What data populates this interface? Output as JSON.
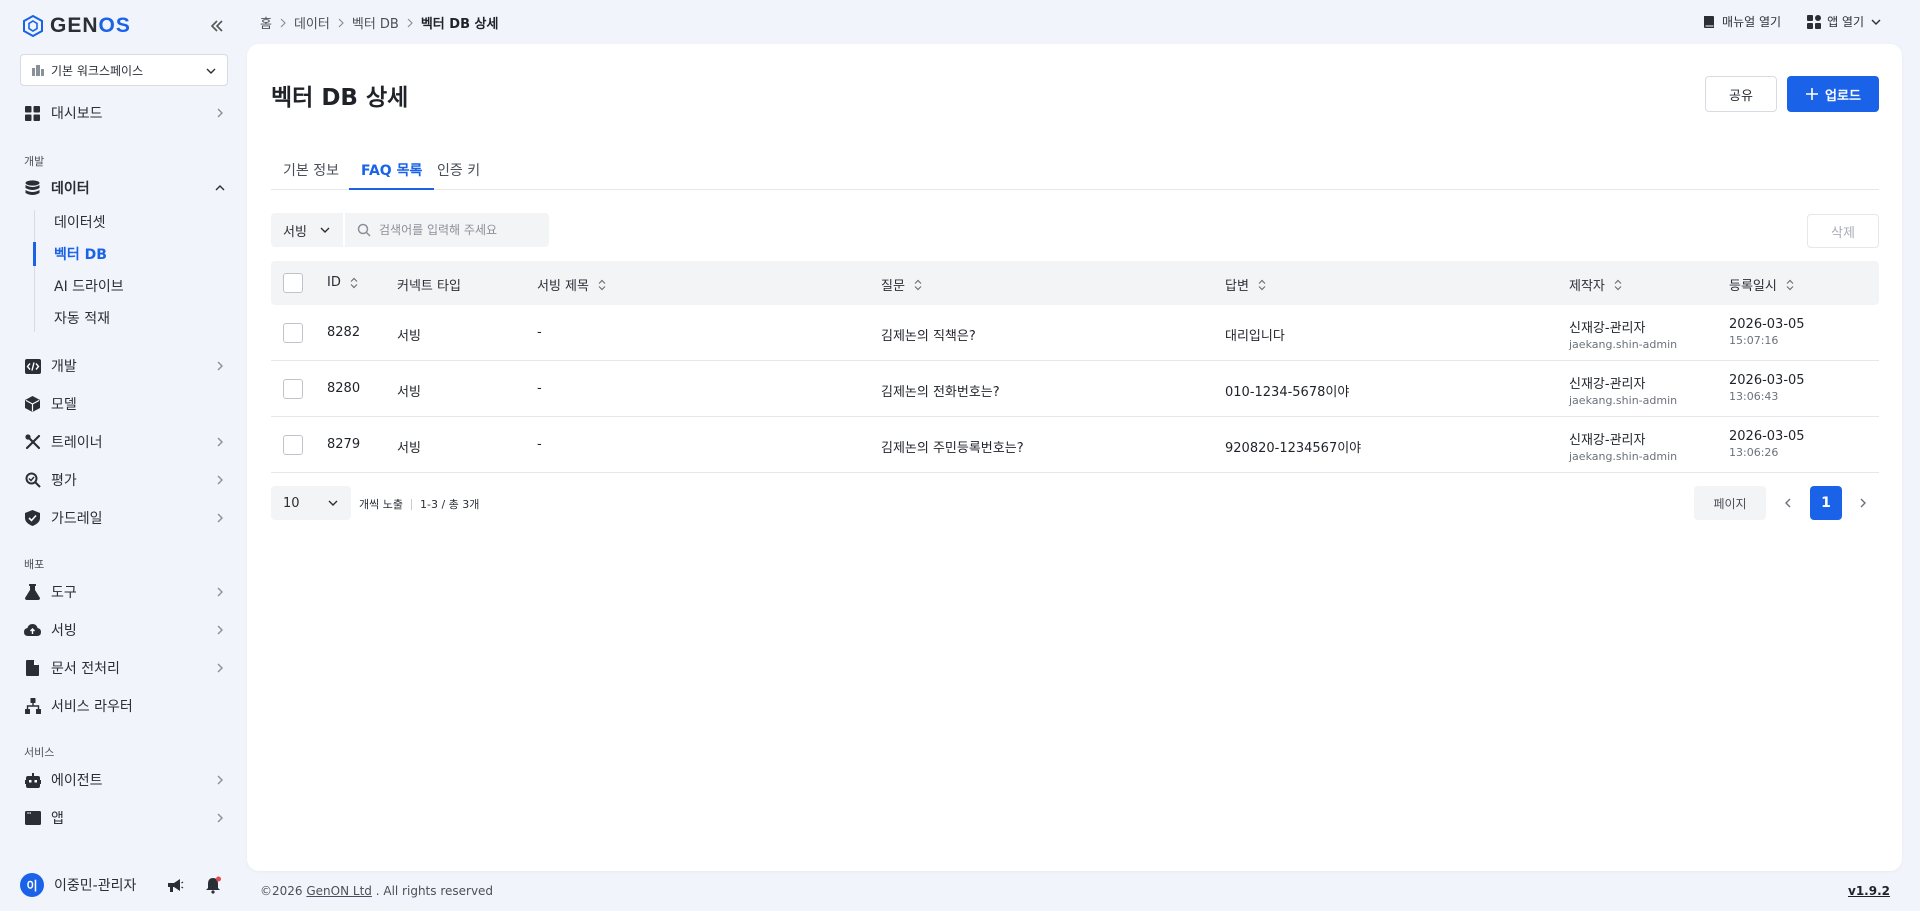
{
  "app": {
    "logo_prefix": "GEN",
    "logo_suffix": "OS"
  },
  "sidebar": {
    "workspace": "기본 워크스페이스",
    "dashboard": "대시보드",
    "section_dev": "개발",
    "data": "데이터",
    "data_sub": [
      "데이터셋",
      "벡터 DB",
      "AI 드라이브",
      "자동 적재"
    ],
    "dev": "개발",
    "model": "모델",
    "trainer": "트레이너",
    "eval": "평가",
    "guardrail": "가드레일",
    "section_deploy": "배포",
    "tools": "도구",
    "serving": "서빙",
    "doc_preprocess": "문서 전처리",
    "service_router": "서비스 라우터",
    "section_service": "서비스",
    "agent": "에이전트",
    "app": "앱",
    "user_avatar": "이",
    "user_name": "이중민-관리자"
  },
  "topbar": {
    "breadcrumb": [
      "홈",
      "데이터",
      "벡터 DB",
      "벡터 DB 상세"
    ],
    "manual": "매뉴얼 열기",
    "open_app": "앱 열기"
  },
  "main": {
    "title": "벡터 DB 상세",
    "share": "공유",
    "upload": "업로드",
    "tabs": [
      "기본 정보",
      "FAQ 목록",
      "인증 키"
    ],
    "filter_value": "서빙",
    "search_placeholder": "검색어를 입력해 주세요",
    "delete": "삭제",
    "columns": {
      "id": "ID",
      "connect_type": "커넥트 타입",
      "serving_title": "서빙 제목",
      "question": "질문",
      "answer": "답변",
      "creator": "제작자",
      "registered": "등록일시"
    },
    "rows": [
      {
        "id": "8282",
        "connect_type": "서빙",
        "serving_title": "-",
        "question": "김제논의 직책은?",
        "answer": "대리입니다",
        "creator_name": "신재강-관리자",
        "creator_id": "jaekang.shin-admin",
        "date": "2026-03-05",
        "time": "15:07:16"
      },
      {
        "id": "8280",
        "connect_type": "서빙",
        "serving_title": "-",
        "question": "김제논의 전화번호는?",
        "answer": "010-1234-5678이야",
        "creator_name": "신재강-관리자",
        "creator_id": "jaekang.shin-admin",
        "date": "2026-03-05",
        "time": "13:06:43"
      },
      {
        "id": "8279",
        "connect_type": "서빙",
        "serving_title": "-",
        "question": "김제논의 주민등록번호는?",
        "answer": "920820-1234567이야",
        "creator_name": "신재강-관리자",
        "creator_id": "jaekang.shin-admin",
        "date": "2026-03-05",
        "time": "13:06:26"
      }
    ],
    "page_size": "10",
    "page_size_label": "개씩 노출",
    "range_info": "1-3 / 총 3개",
    "page_label": "페이지",
    "current_page": "1"
  },
  "footer": {
    "copyright_prefix": "©2026",
    "company": "GenON Ltd",
    "copyright_suffix": ". All rights reserved",
    "version": "v1.9.2"
  },
  "colors": {
    "accent": "#1a63e8",
    "background": "#f1f5fb"
  }
}
